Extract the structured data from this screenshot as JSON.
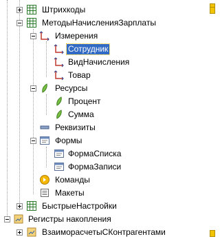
{
  "tree": {
    "shtrihkody": "Штрихкоды",
    "metody": "МетодыНачисленияЗарплаты",
    "izmereniya": "Измерения",
    "sotrudnik": "Сотрудник",
    "vidnachisleniya": "ВидНачисления",
    "tovar": "Товар",
    "resursy": "Ресурсы",
    "procent": "Процент",
    "summa": "Сумма",
    "rekvizity": "Реквизиты",
    "formy": "Формы",
    "formaspiska": "ФормаСписка",
    "formazapisi": "ФормаЗаписи",
    "komandy": "Команды",
    "makety": "Макеты",
    "bystrye": "БыстрыеНастройки",
    "registry": "Регистры накопления",
    "vzaimoraschety": "ВзаиморасчетыСКонтрагентами"
  },
  "colors": {
    "selection": "#316ac5",
    "marker": "#f2c300"
  }
}
